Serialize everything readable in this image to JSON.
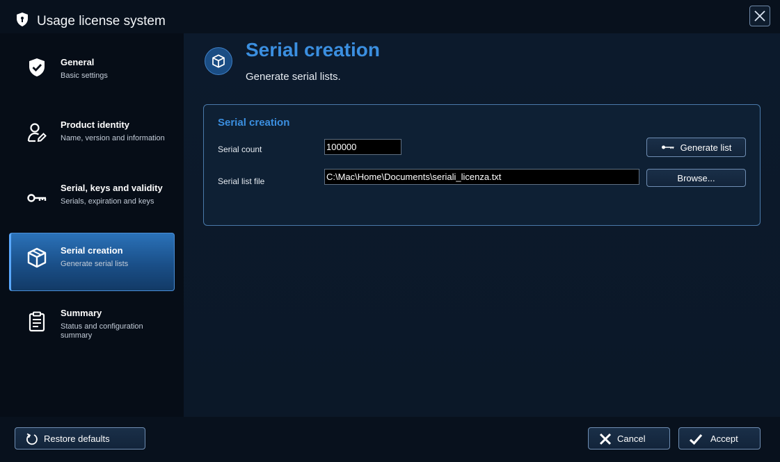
{
  "window": {
    "title": "Usage license system"
  },
  "sidebar": {
    "items": [
      {
        "label": "General",
        "sub": "Basic settings",
        "icon": "shield-check-icon"
      },
      {
        "label": "Product identity",
        "sub": "Name, version and information",
        "icon": "user-edit-icon"
      },
      {
        "label": "Serial, keys and validity",
        "sub": "Serials, expiration and keys",
        "icon": "key-icon"
      },
      {
        "label": "Serial creation",
        "sub": "Generate serial lists",
        "icon": "cube-icon",
        "active": true
      },
      {
        "label": "Summary",
        "sub": "Status and configuration summary",
        "icon": "clipboard-icon"
      }
    ]
  },
  "main": {
    "title": "Serial creation",
    "subtitle": "Generate serial lists.",
    "card": {
      "title": "Serial creation",
      "serial_count_label": "Serial count",
      "serial_count_value": "100000",
      "serial_file_label": "Serial list file",
      "serial_file_value": "C:\\Mac\\Home\\Documents\\seriali_licenza.txt",
      "generate_label": "Generate list",
      "browse_label": "Browse..."
    }
  },
  "footer": {
    "restore_label": "Restore defaults",
    "cancel_label": "Cancel",
    "accept_label": "Accept"
  },
  "colors": {
    "accent": "#3b8fe0",
    "active_nav": "#2b72b9",
    "background": "#0a1422"
  }
}
